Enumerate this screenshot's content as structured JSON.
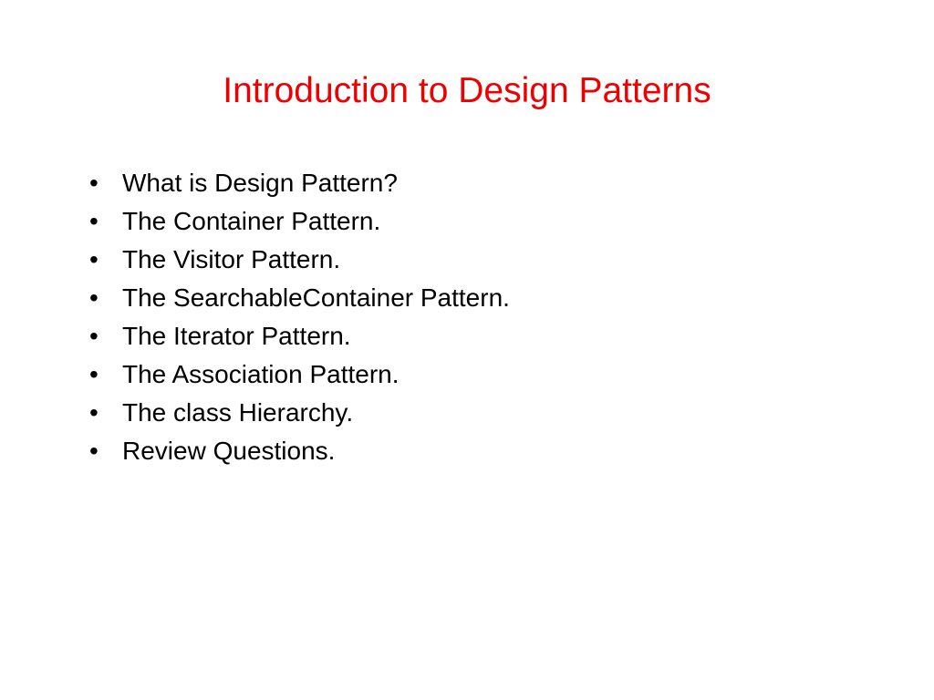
{
  "slide": {
    "title": "Introduction to Design Patterns",
    "bullets": [
      "What is Design Pattern?",
      "The Container Pattern.",
      "The Visitor Pattern.",
      "The SearchableContainer Pattern.",
      "The Iterator Pattern.",
      "The Association Pattern.",
      "The class Hierarchy.",
      "Review Questions."
    ]
  }
}
